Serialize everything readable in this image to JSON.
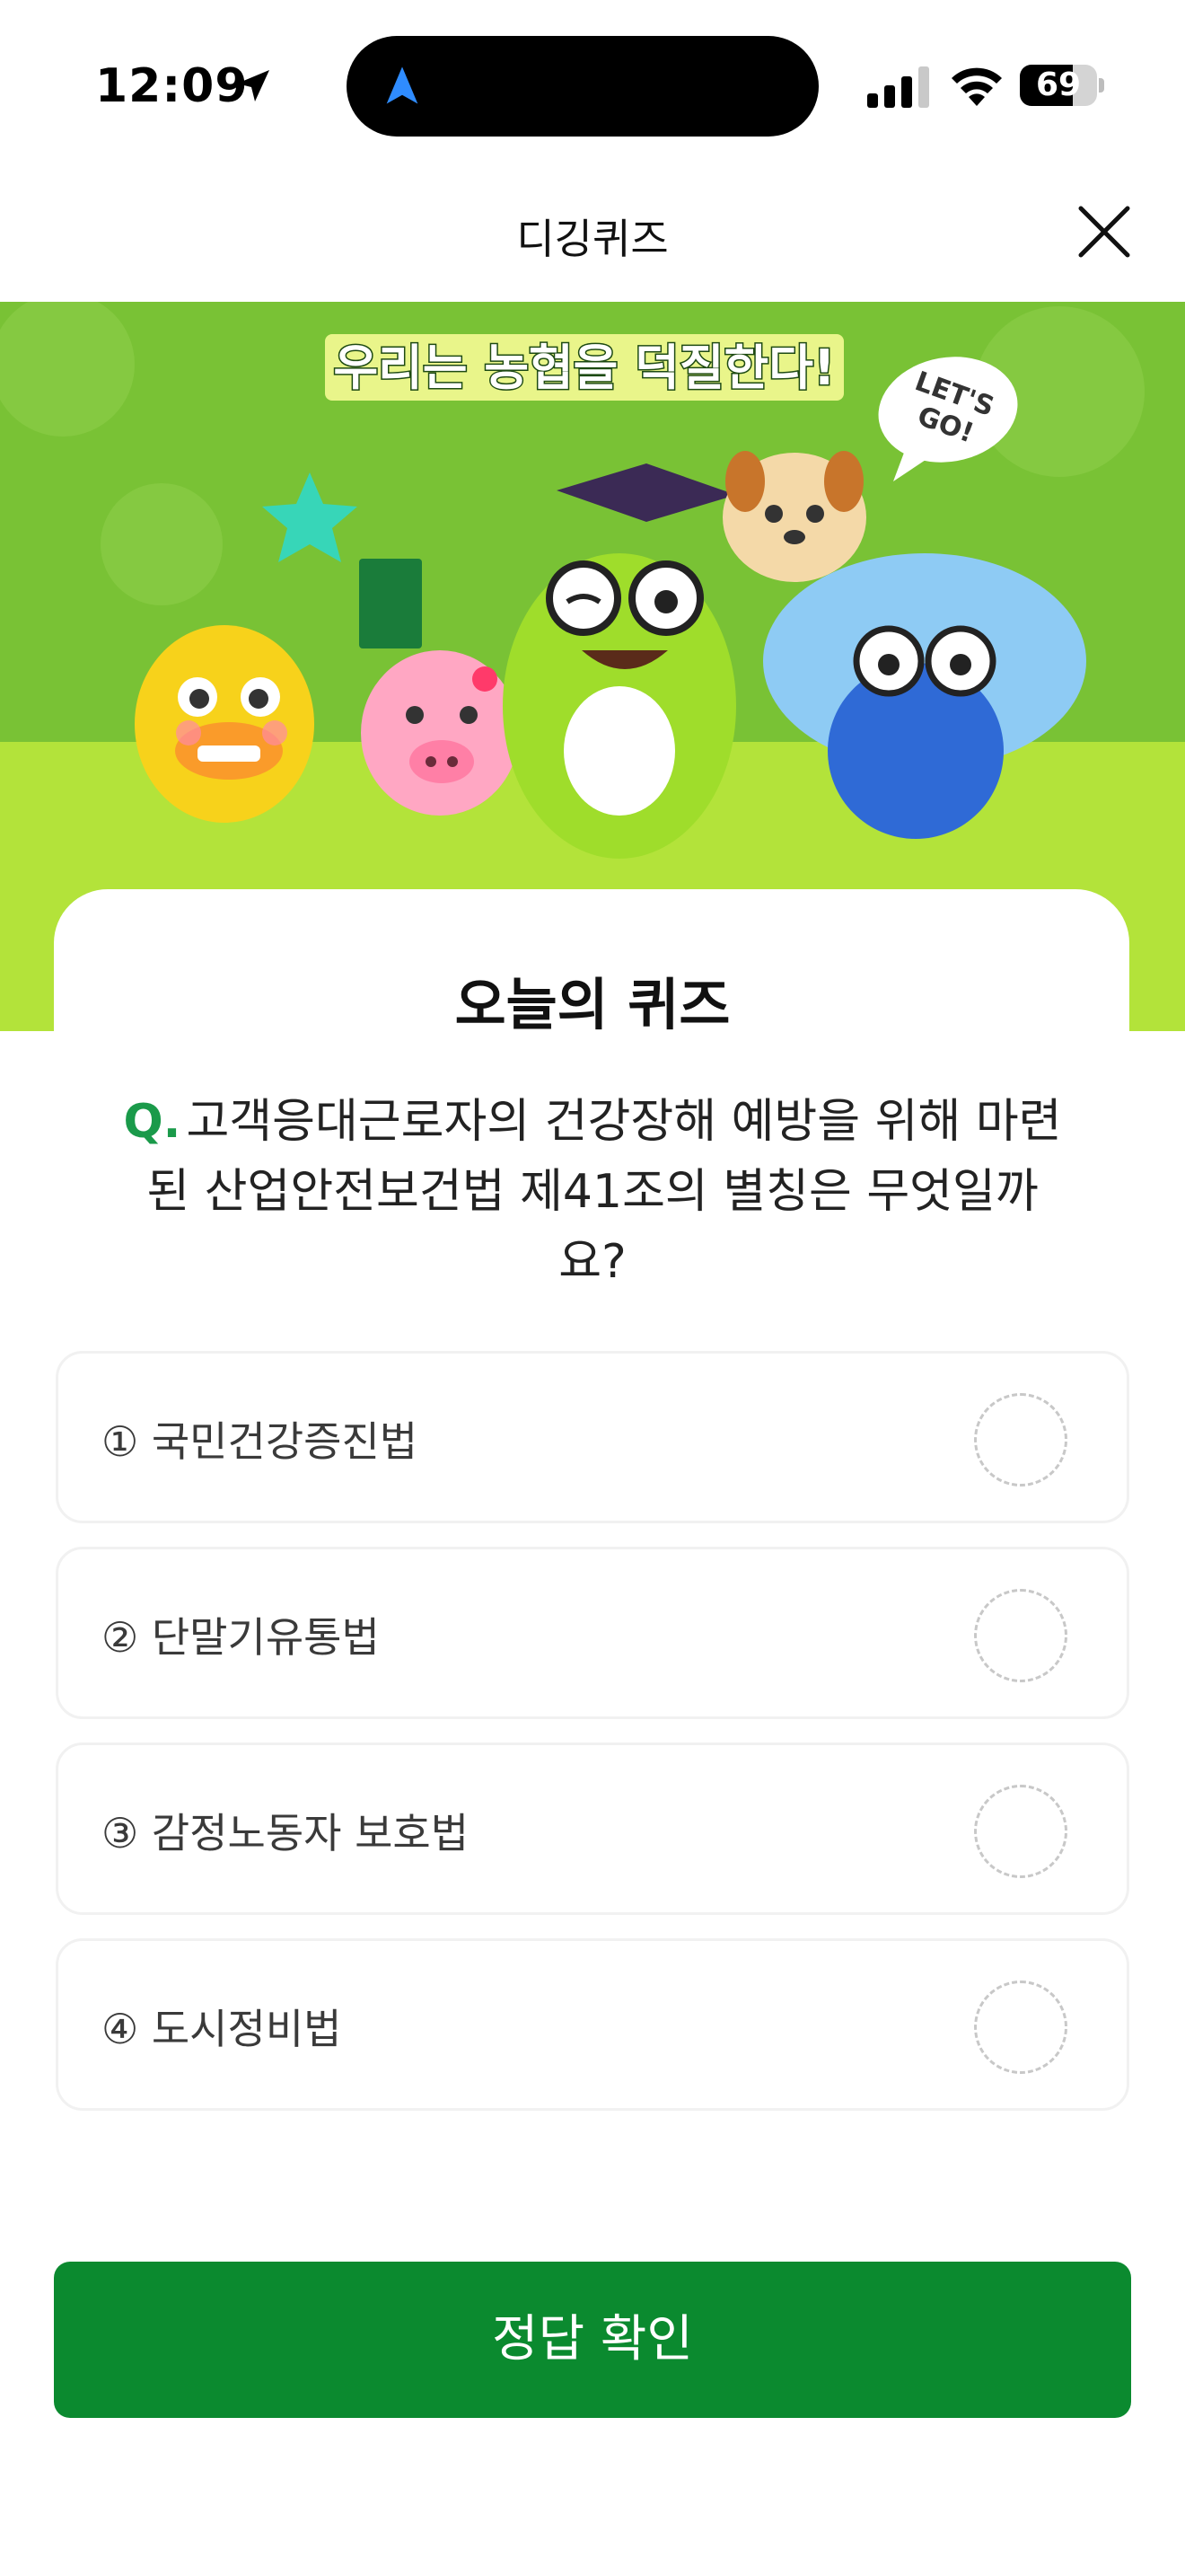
{
  "status_bar": {
    "time": "12:09",
    "battery_level": "69",
    "battery_fraction": 0.69
  },
  "header": {
    "title": "디깅퀴즈",
    "close_icon": "close-icon"
  },
  "banner": {
    "headline": "우리는 농협을 덕질한다!",
    "bubble_line1": "LET'S",
    "bubble_line2": "GO!"
  },
  "quiz": {
    "title": "오늘의 퀴즈",
    "question_mark": "Q.",
    "question_text": "고객응대근로자의 건강장해 예방을 위해 마련된 산업안전보건법 제41조의 별칭은 무엇일까요?",
    "options": [
      {
        "label": "① 국민건강증진법"
      },
      {
        "label": "② 단말기유통법"
      },
      {
        "label": "③ 감정노동자 보호법"
      },
      {
        "label": "④ 도시정비법"
      }
    ],
    "submit_label": "정답 확인"
  },
  "colors": {
    "accent_green": "#0b8a2f",
    "question_mark_green": "#1a9a4a",
    "banner_green": "#8bcf3c"
  }
}
